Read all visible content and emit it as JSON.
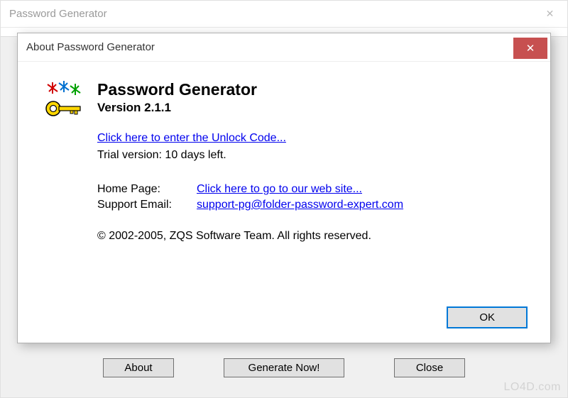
{
  "main": {
    "title": "Password Generator",
    "buttons": {
      "about": "About",
      "generate": "Generate Now!",
      "close": "Close"
    }
  },
  "about": {
    "title": "About Password Generator",
    "app_name": "Password Generator",
    "version": "Version 2.1.1",
    "unlock_link": "Click here to enter the Unlock Code...",
    "trial_text": "Trial version: 10 days left.",
    "info": {
      "home_label": "Home Page:",
      "home_link": "Click here to go to our web site...",
      "support_label": "Support Email:",
      "support_link": "support-pg@folder-password-expert.com"
    },
    "copyright": "© 2002-2005, ZQS Software Team. All rights reserved.",
    "ok": "OK"
  },
  "watermark": "LO4D.com"
}
